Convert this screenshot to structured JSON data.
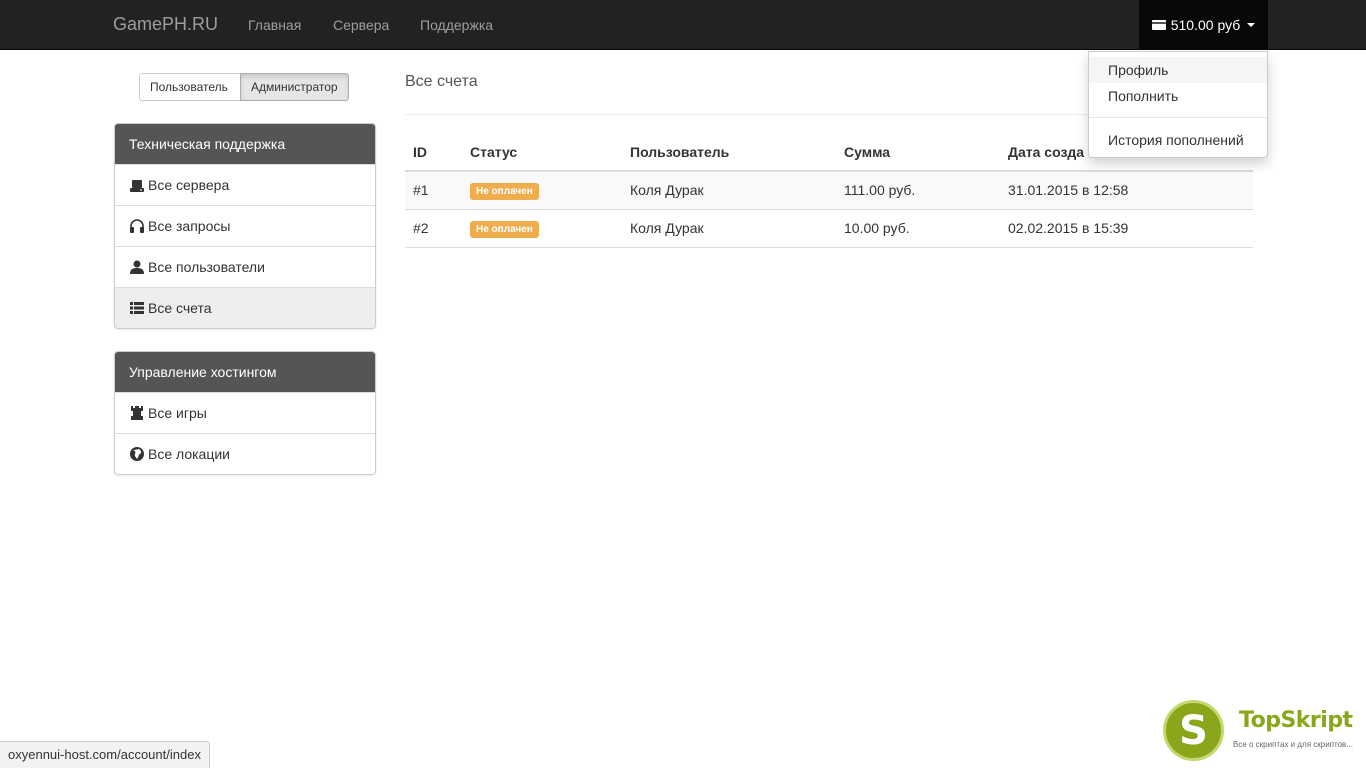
{
  "navbar": {
    "brand": "GamePH.RU",
    "links": [
      "Главная",
      "Сервера",
      "Поддержка"
    ],
    "balance": "510.00 руб"
  },
  "dropdown": {
    "items": [
      "Профиль",
      "Пополнить",
      "История пополнений"
    ]
  },
  "role_toggle": {
    "user_label": "Пользователь",
    "admin_label": "Администратор"
  },
  "sidebar": {
    "support": {
      "title": "Техническая поддержка",
      "items": [
        {
          "label": "Все сервера",
          "icon": "hdd-icon"
        },
        {
          "label": "Все запросы",
          "icon": "headphones-icon"
        },
        {
          "label": "Все пользователи",
          "icon": "user-icon"
        },
        {
          "label": "Все счета",
          "icon": "list-icon"
        }
      ]
    },
    "hosting": {
      "title": "Управление хостингом",
      "items": [
        {
          "label": "Все игры",
          "icon": "tower-icon"
        },
        {
          "label": "Все локации",
          "icon": "globe-icon"
        }
      ]
    }
  },
  "main": {
    "title": "Все счета",
    "table": {
      "headers": [
        "ID",
        "Статус",
        "Пользователь",
        "Сумма",
        "Дата созда"
      ],
      "rows": [
        {
          "id": "#1",
          "status": "Не оплачен",
          "user": "Коля Дурак",
          "amount": "111.00 руб.",
          "date": "31.01.2015 в 12:58"
        },
        {
          "id": "#2",
          "status": "Не оплачен",
          "user": "Коля Дурак",
          "amount": "10.00 руб.",
          "date": "02.02.2015 в 15:39"
        }
      ]
    }
  },
  "statusbar": {
    "url": "oxyennui-host.com/account/index"
  },
  "watermark": {
    "letter": "S",
    "title": "TopSkript",
    "subtitle": "Все о скриптах и для скриптов..."
  },
  "colors": {
    "navbar": "#222222",
    "panel_heading": "#555555",
    "badge_warning": "#f0ad4e",
    "watermark_green": "#8aa61a"
  }
}
